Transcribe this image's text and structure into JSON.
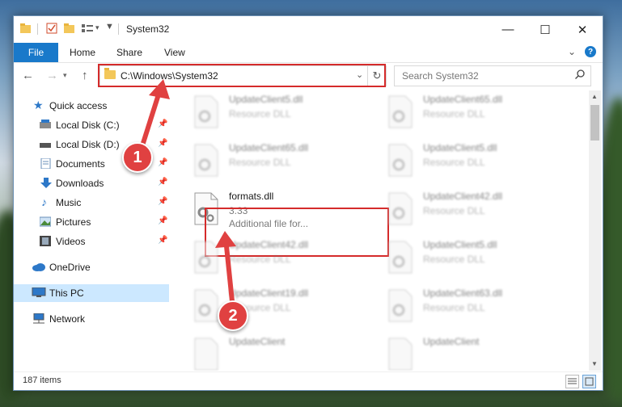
{
  "window": {
    "title": "System32"
  },
  "ribbon": {
    "tabs": [
      "File",
      "Home",
      "Share",
      "View"
    ],
    "help": "?"
  },
  "nav": {
    "address": "C:\\Windows\\System32",
    "search_placeholder": "Search System32"
  },
  "sidebar": {
    "items": [
      {
        "label": "Quick access"
      },
      {
        "label": "Local Disk (C:)"
      },
      {
        "label": "Local Disk (D:)"
      },
      {
        "label": "Documents"
      },
      {
        "label": "Downloads"
      },
      {
        "label": "Music"
      },
      {
        "label": "Pictures"
      },
      {
        "label": "Videos"
      },
      {
        "label": "OneDrive"
      },
      {
        "label": "This PC"
      },
      {
        "label": "Network"
      }
    ]
  },
  "files": [
    {
      "name": "UpdateClient5.dll",
      "type": "Resource DLL"
    },
    {
      "name": "UpdateClient65.dll",
      "type": "Resource DLL"
    },
    {
      "name": "UpdateClient65.dll",
      "type": "Resource DLL"
    },
    {
      "name": "UpdateClient5.dll",
      "type": "Resource DLL"
    },
    {
      "name": "formats.dll",
      "version": "3.33",
      "description": "Additional file for..."
    },
    {
      "name": "UpdateClient42.dll",
      "type": "Resource DLL"
    },
    {
      "name": "UpdateClient42.dll",
      "type": "Resource DLL"
    },
    {
      "name": "UpdateClient5.dll",
      "type": "Resource DLL"
    },
    {
      "name": "UpdateClient19.dll",
      "type": "Resource DLL"
    },
    {
      "name": "UpdateClient63.dll",
      "type": "Resource DLL"
    },
    {
      "name": "UpdateClient",
      "type": ""
    },
    {
      "name": "UpdateClient",
      "type": ""
    }
  ],
  "status": {
    "items": "187 items"
  },
  "annotations": {
    "step1": "1",
    "step2": "2",
    "color": "#e04141"
  }
}
